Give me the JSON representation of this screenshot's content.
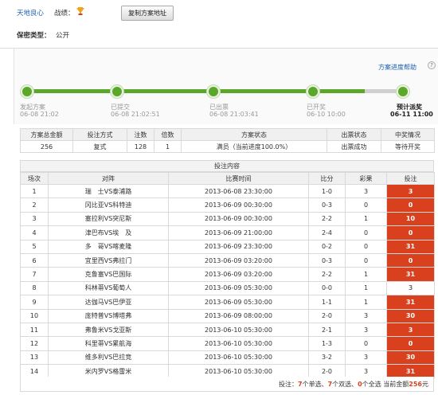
{
  "user": {
    "name": "天地良心",
    "record_label": "战绩：",
    "trophy_icon": "trophy-icon"
  },
  "copy_button": "复制方案地址",
  "secret": {
    "label": "保密类型：",
    "value": "公开"
  },
  "help_link": "方案进度帮助",
  "progress": {
    "steps": [
      {
        "label": "发起方案",
        "time": "06-08 21:02",
        "done": true
      },
      {
        "label": "已提交",
        "time": "06-08 21:02:51",
        "done": true
      },
      {
        "label": "已出票",
        "time": "06-08 21:03:41",
        "done": true
      },
      {
        "label": "已开奖",
        "time": "06-10 10:00",
        "done": true
      },
      {
        "label": "预计派奖",
        "time": "06-11 11:00",
        "done": true
      }
    ]
  },
  "summary": {
    "headers": [
      "方案总金额",
      "投注方式",
      "注数",
      "倍数",
      "方案状态",
      "出票状态",
      "中奖情况"
    ],
    "row": [
      "256",
      "复式",
      "128",
      "1",
      "满员（当前进度100.0%）",
      "出票成功",
      "等待开奖"
    ]
  },
  "bets": {
    "title": "投注内容",
    "headers": [
      "场次",
      "对阵",
      "比赛时间",
      "比分",
      "彩果",
      "投注"
    ],
    "rows": [
      [
        "1",
        "瑞　士VS泰浦路",
        "2013-06-08 23:30:00",
        "1-0",
        "3",
        "3"
      ],
      [
        "2",
        "冈比亚VS科特迪",
        "2013-06-09 00:30:00",
        "0-3",
        "0",
        "0"
      ],
      [
        "3",
        "塞拉利VS突尼斯",
        "2013-06-09 00:30:00",
        "2-2",
        "1",
        "10"
      ],
      [
        "4",
        "津巴布VS埃　及",
        "2013-06-09 21:00:00",
        "2-4",
        "0",
        "0"
      ],
      [
        "5",
        "多　哥VS喀麦隆",
        "2013-06-09 23:30:00",
        "0-2",
        "0",
        "31"
      ],
      [
        "6",
        "宜里西VS弗拉门",
        "2013-06-09 03:20:00",
        "0-3",
        "0",
        "0"
      ],
      [
        "7",
        "克鲁塞VS巴国际",
        "2013-06-09 03:20:00",
        "2-2",
        "1",
        "31"
      ],
      [
        "8",
        "科林蒂VS葡萄人",
        "2013-06-09 05:30:00",
        "0-0",
        "1",
        "3"
      ],
      [
        "9",
        "达伽马VS巴伊亚",
        "2013-06-09 05:30:00",
        "1-1",
        "1",
        "31"
      ],
      [
        "10",
        "庞特普VS博塔弗",
        "2013-06-09 08:00:00",
        "2-0",
        "3",
        "30"
      ],
      [
        "11",
        "弗鲁米VS戈亚斯",
        "2013-06-10 05:30:00",
        "2-1",
        "3",
        "3"
      ],
      [
        "12",
        "科里蒂VS累航海",
        "2013-06-10 05:30:00",
        "1-3",
        "0",
        "0"
      ],
      [
        "13",
        "维多利VS巴拉竞",
        "2013-06-10 05:30:00",
        "3-2",
        "3",
        "30"
      ],
      [
        "14",
        "米内罗VS格雷米",
        "2013-06-10 05:30:00",
        "2-0",
        "3",
        "31"
      ]
    ],
    "pick_plain_rows": [
      8
    ]
  },
  "footer": {
    "prefix": "投注：",
    "single": "7",
    "single_suffix": "个单选、",
    "double": "7",
    "double_suffix": "个双选、",
    "full": "0",
    "full_suffix": "个全选 当前金额",
    "amount": "256",
    "unit": "元"
  },
  "colors": {
    "accent_green": "#5aa72a",
    "pick_red": "#d9411e",
    "link_blue": "#1e5faf"
  }
}
